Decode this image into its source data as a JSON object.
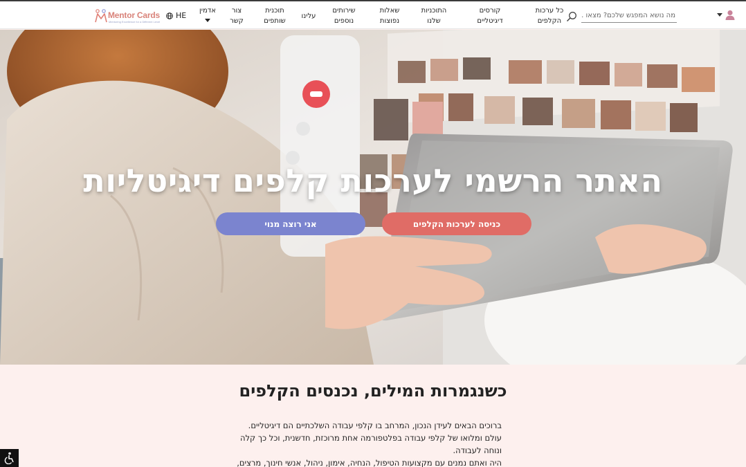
{
  "header": {
    "search": {
      "placeholder": "מה נושא המפגש שלכם? מצאו ..."
    },
    "nav": [
      {
        "id": "all-decks",
        "lines": [
          "כל ערכות",
          "הקלפים"
        ]
      },
      {
        "id": "digital-courses",
        "lines": [
          "קורסים",
          "דיגיטליים"
        ]
      },
      {
        "id": "our-programs",
        "lines": [
          "התוכניות",
          "שלנו"
        ]
      },
      {
        "id": "faq",
        "lines": [
          "שאלות",
          "נפוצות"
        ]
      },
      {
        "id": "additional-services",
        "lines": [
          "שירותים",
          "נוספים"
        ]
      },
      {
        "id": "about",
        "lines": [
          "עלינו"
        ]
      },
      {
        "id": "partners-program",
        "lines": [
          "תוכנית",
          "שותפים"
        ]
      },
      {
        "id": "contact",
        "lines": [
          "צור",
          "קשר"
        ]
      },
      {
        "id": "admin",
        "lines": [
          "אדמין"
        ]
      }
    ],
    "language": "HE",
    "logo": {
      "brand": "Mentor Cards",
      "tagline": "Mentoring Excellence for a Different Level"
    }
  },
  "hero": {
    "title": "האתר הרשמי לערכות קלפים דיגיטליות",
    "primary_button": "כניסה לערכות הקלפים",
    "secondary_button": "אני רוצה מנוי"
  },
  "intro": {
    "title": "כשנגמרות המילים, נכנסים הקלפים",
    "paragraphs": [
      "ברוכים הבאים לעידן הנכון, המרחב בו קלפי עבודה השלכתיים הם דיגיטליים.",
      "עולם ומלואו של קלפי עבודה בפלטפורמה אחת מרוכזת, חדשנית, וכל כך קלה ונוחה לעבודה.",
      "היה ואתם נמנים עם מקצועות הטיפול, הנחיה, אימון, ניהול, אנשי חינוך, מרצים,"
    ]
  },
  "colors": {
    "primary": "#e06c66",
    "secondary": "#7b84cf",
    "section_bg": "#fdf0ee"
  },
  "icons": [
    "user-icon",
    "search-icon",
    "globe-icon",
    "accessibility-icon",
    "logo-mark-icon"
  ]
}
